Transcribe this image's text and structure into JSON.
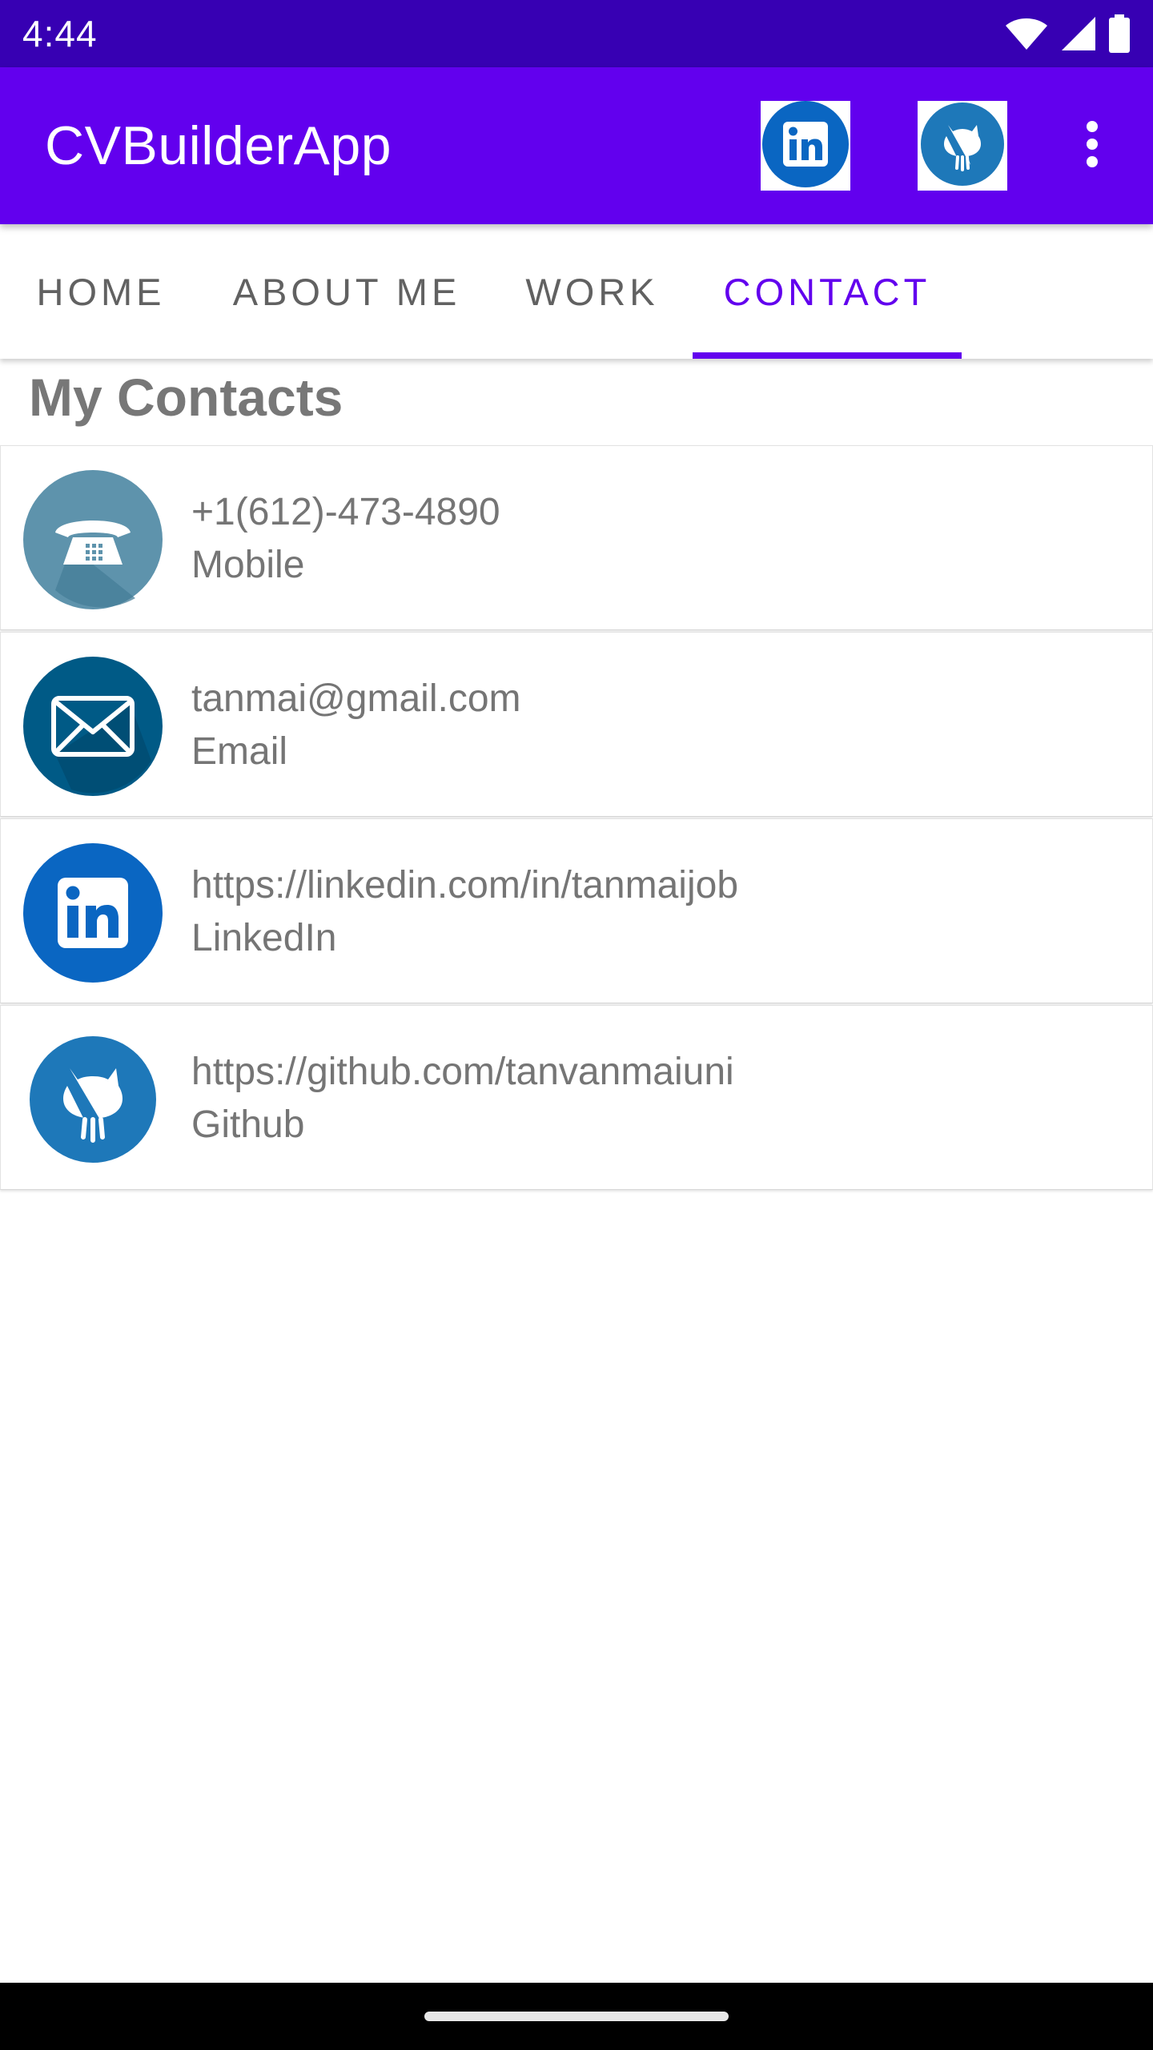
{
  "status_bar": {
    "time": "4:44",
    "icons": [
      "wifi-icon",
      "cellular-signal-icon",
      "battery-icon"
    ]
  },
  "app_bar": {
    "title": "CVBuilderApp",
    "actions": [
      "linkedin-icon",
      "github-icon",
      "more-vert-icon"
    ],
    "colors": {
      "primary": "#6200ee",
      "status": "#3700b3"
    }
  },
  "tabs": [
    {
      "label": "HOME"
    },
    {
      "label": "ABOUT ME"
    },
    {
      "label": "WORK"
    },
    {
      "label": "CONTACT",
      "active": true
    }
  ],
  "main": {
    "heading": "My Contacts",
    "contacts": [
      {
        "value": "+1(612)-473-4890",
        "type": "Mobile",
        "icon": "phone-icon"
      },
      {
        "value": "tanmai@gmail.com",
        "type": "Email",
        "icon": "email-icon"
      },
      {
        "value": "https://linkedin.com/in/tanmaijob",
        "type": "LinkedIn",
        "icon": "linkedin-icon"
      },
      {
        "value": "https://github.com/tanvanmaiuni",
        "type": "Github",
        "icon": "github-icon"
      }
    ]
  }
}
